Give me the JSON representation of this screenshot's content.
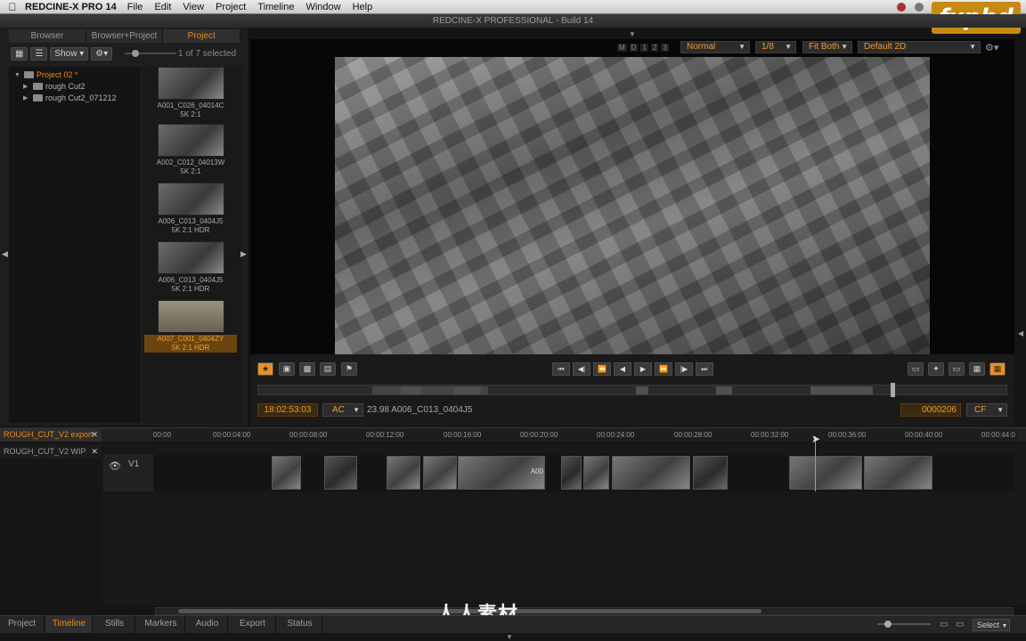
{
  "menubar": {
    "app_name": "REDCINE-X PRO 14",
    "items": [
      "File",
      "Edit",
      "View",
      "Project",
      "Timeline",
      "Window",
      "Help"
    ],
    "logo_text": "fxphd"
  },
  "window_title": "REDCINE-X PROFESSIONAL - Build 14",
  "left_tabs": [
    "Browser",
    "Browser+Project",
    "Project"
  ],
  "left_toolbar": {
    "show_label": "Show",
    "selection_count": "1 of 7 selected"
  },
  "project_tree": [
    {
      "label": "Project 02 *",
      "selected": true
    },
    {
      "label": "rough Cut2"
    },
    {
      "label": "rough Cut2_071212"
    }
  ],
  "clips": [
    {
      "name": "A001_C026_04014C",
      "info": "5K 2:1"
    },
    {
      "name": "A002_C012_04013W",
      "info": "5K 2:1"
    },
    {
      "name": "A006_C013_0404J5",
      "info": "5K 2:1 HDR"
    },
    {
      "name": "A006_C013_0404J5",
      "info": "5K 2:1 HDR"
    },
    {
      "name": "A007_C001_0404ZY",
      "info": "5K 2:1 HDR",
      "selected": true
    }
  ],
  "viewer": {
    "modes": [
      "M",
      "D",
      "1",
      "2",
      "3"
    ],
    "blend": "Normal",
    "resolution": "1/8",
    "fit": "Fit Both",
    "display": "Default 2D"
  },
  "transport": {
    "timecode": "18:02:53:03",
    "tc_mode": "AC",
    "clip_info": "23.98 A006_C013_0404J5",
    "frame": "0000206",
    "frame_mode": "CF"
  },
  "timeline": {
    "sequences": [
      "ROUGH_CUT_V2 export",
      "ROUGH_CUT_V2 WIP"
    ],
    "track_label": "V1",
    "clip_overlay_text": "A00",
    "ruler": [
      "00:00",
      "00:00:04:00",
      "00:00:08:00",
      "00:00:12:00",
      "00:00:16:00",
      "00:00:20:00",
      "00:00:24:00",
      "00:00:28:00",
      "00:00:32:00",
      "00:00:36:00",
      "00:00:40:00",
      "00:00:44:0"
    ]
  },
  "bottom_tabs": [
    "Project",
    "Timeline",
    "Stills",
    "Markers",
    "Audio",
    "Export",
    "Status"
  ],
  "bottom_active": "Timeline",
  "select_label": "Select",
  "watermark_text": "人人素材"
}
